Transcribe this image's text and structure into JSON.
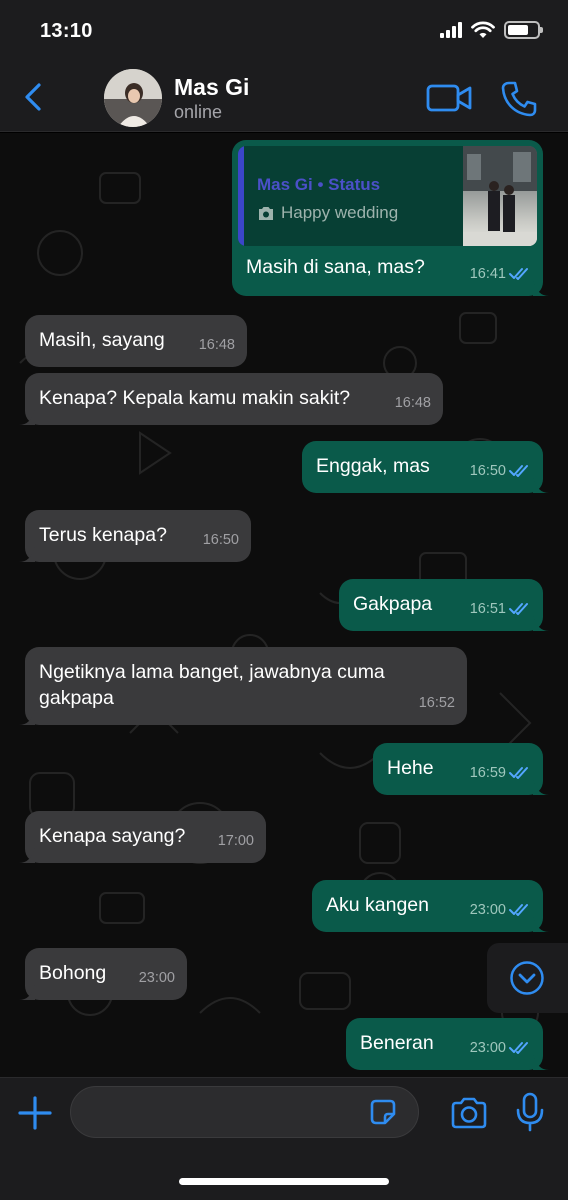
{
  "status_bar": {
    "time": "13:10"
  },
  "header": {
    "contact_name": "Mas Gi",
    "contact_status": "online"
  },
  "quoted_status": {
    "title": "Mas Gi • Status",
    "text": "Happy wedding"
  },
  "messages": [
    {
      "side": "out",
      "text": "Masih di sana, mas?",
      "time": "16:41"
    },
    {
      "side": "in",
      "text": "Masih, sayang",
      "time": "16:48"
    },
    {
      "side": "in",
      "text": "Kenapa? Kepala kamu makin sakit?",
      "time": "16:48"
    },
    {
      "side": "out",
      "text": "Enggak, mas",
      "time": "16:50"
    },
    {
      "side": "in",
      "text": "Terus kenapa?",
      "time": "16:50"
    },
    {
      "side": "out",
      "text": "Gakpapa",
      "time": "16:51"
    },
    {
      "side": "in",
      "text": "Ngetiknya lama banget, jawabnya cuma gakpapa",
      "time": "16:52"
    },
    {
      "side": "out",
      "text": "Hehe",
      "time": "16:59"
    },
    {
      "side": "in",
      "text": "Kenapa sayang?",
      "time": "17:00"
    },
    {
      "side": "out",
      "text": "Aku kangen",
      "time": "23:00"
    },
    {
      "side": "in",
      "text": "Bohong",
      "time": "23:00"
    },
    {
      "side": "out",
      "text": "Beneran",
      "time": "23:00"
    }
  ],
  "input": {
    "value": "",
    "placeholder": ""
  },
  "icons": {
    "back": "chevron-left-icon",
    "video": "video-camera-icon",
    "call": "phone-icon",
    "plus": "plus-icon",
    "sticker": "sticker-icon",
    "camera": "camera-icon",
    "mic": "microphone-icon",
    "scroll": "chevron-down-circle-icon",
    "read": "double-check-icon"
  },
  "colors": {
    "accent": "#2f8cf0",
    "incoming_bubble": "#3a3a3c",
    "outgoing_bubble": "#0a5a4a",
    "read_ticks": "#53a6ff",
    "quote_accent": "#3b46c8"
  }
}
